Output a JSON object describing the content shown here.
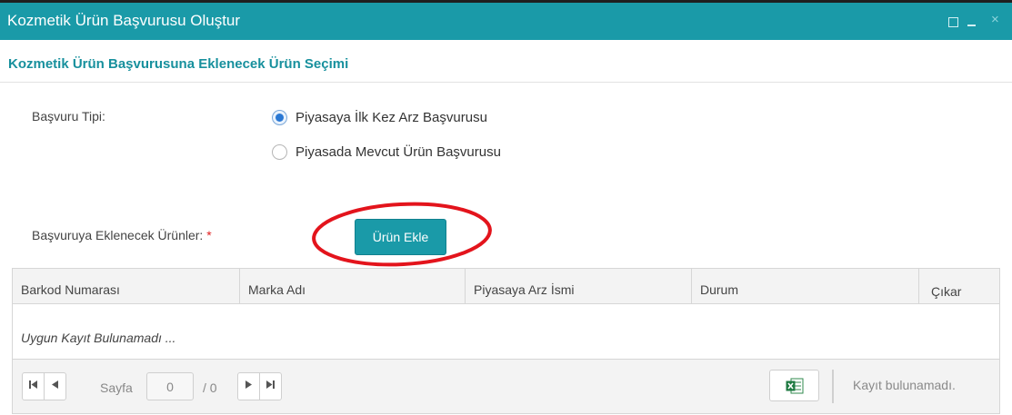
{
  "window": {
    "title": "Kozmetik Ürün Başvurusu Oluştur",
    "controls": {
      "maximize_icon": "maximize-icon",
      "minimize_icon": "minimize-icon",
      "close_glyph": "×"
    }
  },
  "section": {
    "title": "Kozmetik Ürün Başvurusuna Eklenecek Ürün Seçimi"
  },
  "application_type": {
    "label": "Başvuru Tipi:",
    "options": [
      {
        "label": "Piyasaya İlk Kez Arz Başvurusu",
        "checked": true
      },
      {
        "label": "Piyasada Mevcut Ürün Başvurusu",
        "checked": false
      }
    ]
  },
  "products": {
    "label": "Başvuruya Eklenecek Ürünler:",
    "required_mark": "*",
    "add_button": "Ürün Ekle",
    "highlight_color": "#e3141c"
  },
  "grid": {
    "columns": [
      "Barkod Numarası",
      "Marka Adı",
      "Piyasaya Arz İsmi",
      "Durum",
      "Çıkar"
    ],
    "empty_message": "Uygun Kayıt Bulunamadı ...",
    "pager": {
      "first_glyph": "⏮",
      "prev_glyph": "◀",
      "next_glyph": "▶",
      "last_glyph": "⏭",
      "page_label": "Sayfa",
      "page_value": "0",
      "page_total": "/ 0",
      "export_icon": "excel-icon",
      "record_info": "Kayıt bulunamadı."
    }
  },
  "colors": {
    "accent": "#1a9aa8",
    "section_title": "#17909d",
    "radio_checked": "#2a78d4"
  }
}
